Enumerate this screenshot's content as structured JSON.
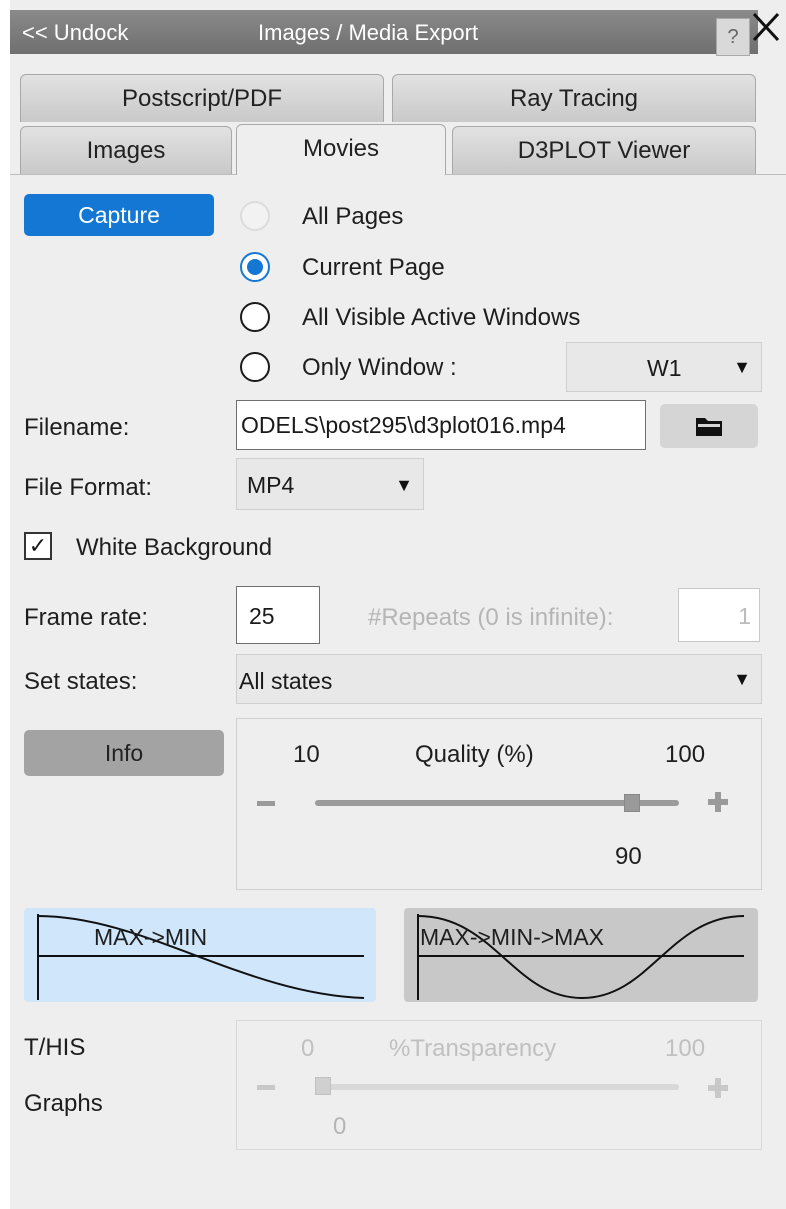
{
  "window": {
    "undock_label": "<< Undock",
    "title": "Images / Media Export",
    "help_label": "?"
  },
  "tabs": {
    "row1": [
      "Postscript/PDF",
      "Ray Tracing"
    ],
    "row2": [
      "Images",
      "Movies",
      "D3PLOT Viewer"
    ],
    "active": "Movies"
  },
  "capture": {
    "button_label": "Capture",
    "options": [
      {
        "label": "All Pages",
        "state": "disabled"
      },
      {
        "label": "Current Page",
        "state": "selected"
      },
      {
        "label": "All Visible Active Windows",
        "state": "unselected"
      },
      {
        "label": "Only Window :",
        "state": "unselected"
      }
    ],
    "window_select": "W1"
  },
  "file": {
    "filename_label": "Filename:",
    "filename_value": "ODELS\\post295\\d3plot016.mp4",
    "format_label": "File Format:",
    "format_value": "MP4"
  },
  "white_background": {
    "label": "White Background",
    "checked": true
  },
  "frame": {
    "rate_label": "Frame rate:",
    "rate_value": "25",
    "repeats_label": "#Repeats (0 is infinite):",
    "repeats_value": "1"
  },
  "states": {
    "label": "Set states:",
    "value": "All states"
  },
  "info_button_label": "Info",
  "quality": {
    "min_label": "10",
    "title": "Quality (%)",
    "max_label": "100",
    "value": "90",
    "fraction": 0.889
  },
  "animation_modes": [
    {
      "label": "MAX->MIN",
      "selected": true
    },
    {
      "label": "MAX->MIN->MAX",
      "selected": false
    }
  ],
  "thistory": {
    "label_line1": "T/HIS",
    "label_line2": "Graphs",
    "min_label": "0",
    "title": "%Transparency",
    "max_label": "100",
    "value": "0",
    "fraction": 0.0
  },
  "colors": {
    "accent": "#1477d4",
    "title_bar": "#7a7a7a",
    "panel_bg": "#eeeeee",
    "selected_mode_bg": "#cfe6fb",
    "unselected_mode_bg": "#c8c8c8"
  }
}
